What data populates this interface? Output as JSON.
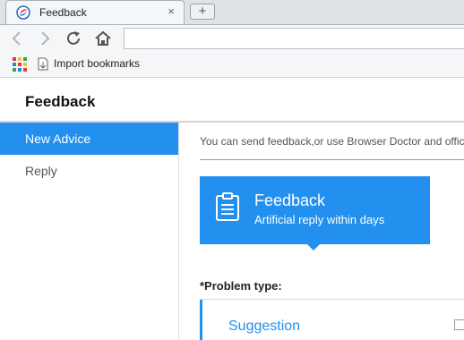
{
  "browser": {
    "tab_title": "Feedback",
    "tab_close": "×",
    "new_tab": "+",
    "address_value": "",
    "bookmark_label": "Import bookmarks"
  },
  "page": {
    "title": "Feedback",
    "sidebar": {
      "items": [
        {
          "label": "New Advice",
          "active": true
        },
        {
          "label": "Reply",
          "active": false
        }
      ]
    },
    "notice": "You can send feedback,or use Browser Doctor and official",
    "feedback_card": {
      "title": "Feedback",
      "subtitle": "Artificial reply within days"
    },
    "problem_type_label": "*Problem type:",
    "problem_options": [
      "Suggestion"
    ]
  },
  "colors": {
    "accent": "#2390f0",
    "tab_strip": "#dfe3e8",
    "toolbar": "#f5f6f7"
  },
  "icons": {
    "tab_logo": "browser-logo-icon",
    "back": "back-arrow-icon",
    "forward": "forward-arrow-icon",
    "reload": "reload-icon",
    "home": "home-icon",
    "apps": "apps-grid-icon",
    "bookmark_doc": "import-file-icon",
    "feedback": "clipboard-icon"
  }
}
